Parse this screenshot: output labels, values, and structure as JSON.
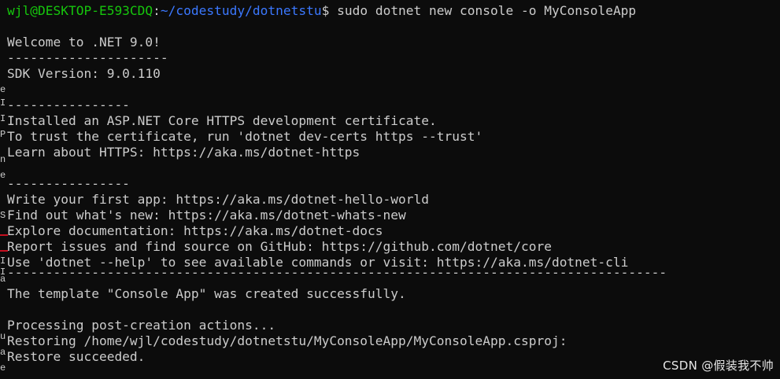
{
  "prompt": {
    "user_host": "wjl@DESKTOP-E593CDQ",
    "separator": ":",
    "path": "~/codestudy/dotnetstu",
    "symbol": "$ ",
    "command": "sudo dotnet new console -o MyConsoleApp"
  },
  "output": [
    "Welcome to .NET 9.0!",
    "---------------------",
    "SDK Version: 9.0.110",
    "----------------",
    "Installed an ASP.NET Core HTTPS development certificate.",
    "To trust the certificate, run 'dotnet dev-certs https --trust'",
    "Learn about HTTPS: https://aka.ms/dotnet-https",
    "----------------",
    "Write your first app: https://aka.ms/dotnet-hello-world",
    "Find out what's new: https://aka.ms/dotnet-whats-new",
    "Explore documentation: https://aka.ms/dotnet-docs",
    "Report issues and find source on GitHub: https://github.com/dotnet/core",
    "Use 'dotnet --help' to see available commands or visit: https://aka.ms/dotnet-cli",
    "--------------------------------------------------------------------------------------",
    "The template \"Console App\" was created successfully.",
    "Processing post-creation actions...",
    "Restoring /home/wjl/codestudy/dotnetstu/MyConsoleApp/MyConsoleApp.csproj:",
    "Restore succeeded."
  ],
  "gutter": [
    "e",
    "I",
    "I",
    "P",
    "n",
    "e",
    "S",
    "I",
    "I",
    "a",
    "u",
    "a",
    "e"
  ],
  "watermark": "CSDN @假装我不帅",
  "colors": {
    "background": "#0c0c0c",
    "text": "#cccccc",
    "prompt_user": "#16c60c",
    "prompt_path": "#3b78ff",
    "gutter_mark": "#c50f1f"
  }
}
